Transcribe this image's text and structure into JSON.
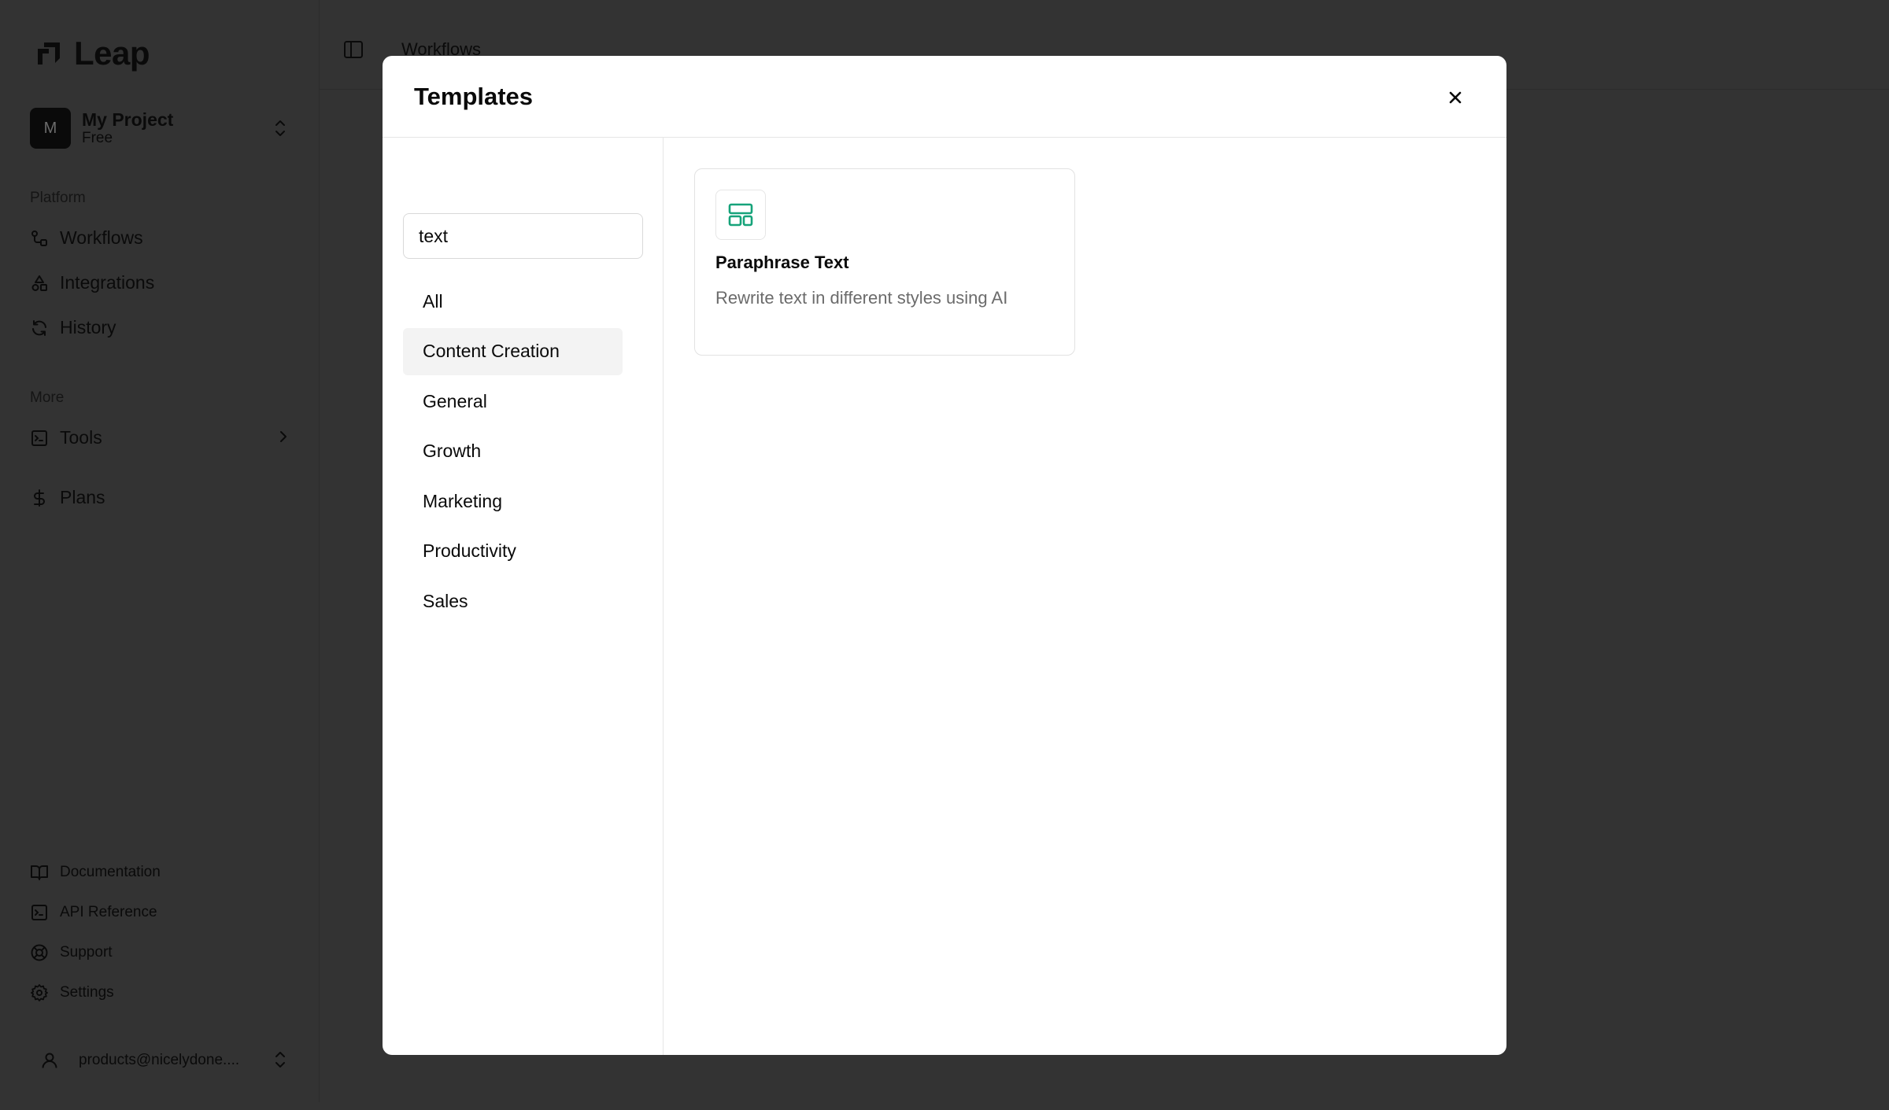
{
  "app": {
    "brand": "Leap",
    "project": {
      "avatar_letter": "M",
      "name": "My Project",
      "plan": "Free"
    },
    "sections": {
      "platform": "Platform",
      "more": "More"
    },
    "nav": [
      {
        "label": "Workflows",
        "icon": "workflow-icon"
      },
      {
        "label": "Integrations",
        "icon": "shapes-icon"
      },
      {
        "label": "History",
        "icon": "refresh-icon"
      }
    ],
    "more_nav": [
      {
        "label": "Tools",
        "icon": "terminal-icon"
      },
      {
        "label": "Plans",
        "icon": "dollar-icon"
      }
    ],
    "footer_nav": [
      {
        "label": "Documentation",
        "icon": "book-icon"
      },
      {
        "label": "API Reference",
        "icon": "terminal-icon"
      },
      {
        "label": "Support",
        "icon": "lifebuoy-icon"
      },
      {
        "label": "Settings",
        "icon": "gear-icon"
      }
    ],
    "user_email": "products@nicelydone....",
    "breadcrumb": "Workflows"
  },
  "modal": {
    "title": "Templates",
    "search_value": "text",
    "categories": [
      {
        "label": "All",
        "active": false
      },
      {
        "label": "Content Creation",
        "active": true
      },
      {
        "label": "General",
        "active": false
      },
      {
        "label": "Growth",
        "active": false
      },
      {
        "label": "Marketing",
        "active": false
      },
      {
        "label": "Productivity",
        "active": false
      },
      {
        "label": "Sales",
        "active": false
      }
    ],
    "templates": [
      {
        "title": "Paraphrase Text",
        "description": "Rewrite text in different styles using AI",
        "icon": "layout-icon",
        "icon_color": "#16a37a"
      }
    ]
  }
}
